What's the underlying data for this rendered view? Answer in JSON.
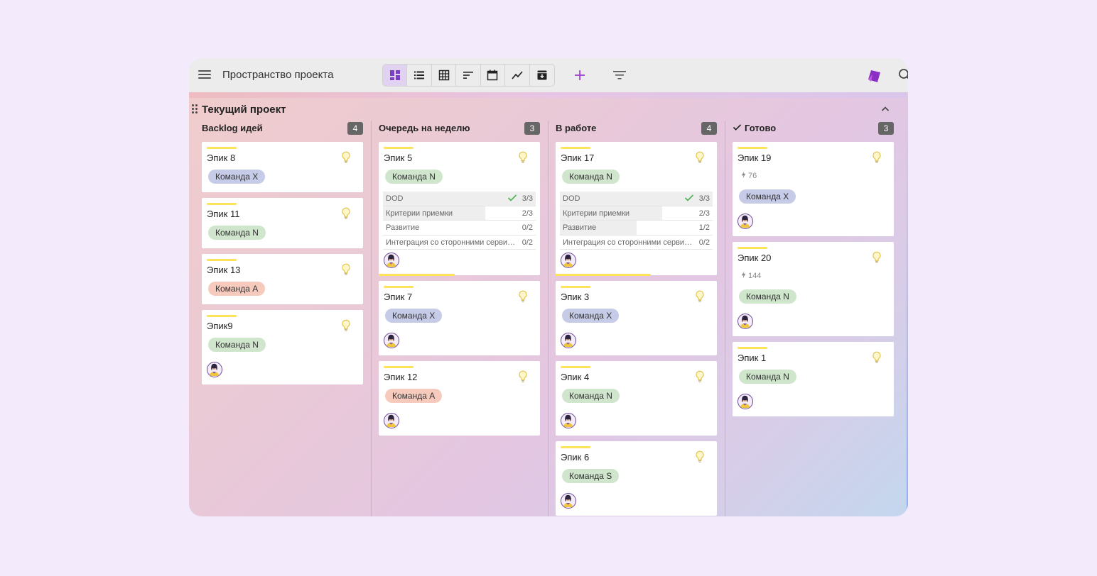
{
  "toolbar": {
    "title": "Пространство проекта",
    "views": [
      "board-icon",
      "list-icon",
      "table-icon",
      "sort-icon",
      "calendar-icon",
      "chart-icon",
      "archive-icon"
    ],
    "active_view": "board-icon",
    "accent": "#9b3fd1"
  },
  "board": {
    "section_title": "Текущий проект",
    "columns": [
      {
        "title": "Backlog идей",
        "count": "4",
        "cards": [
          {
            "title": "Эпик 8",
            "tag": "Команда X",
            "tag_color": "x"
          },
          {
            "title": "Эпик 11",
            "tag": "Команда N",
            "tag_color": "n"
          },
          {
            "title": "Эпик 13",
            "tag": "Команда A",
            "tag_color": "a"
          },
          {
            "title": "Эпик9",
            "tag": "Команда N",
            "tag_color": "n",
            "avatar": true
          }
        ]
      },
      {
        "title": "Очередь на неделю",
        "count": "3",
        "cards": [
          {
            "title": "Эпик 5",
            "tag": "Команда N",
            "tag_color": "n",
            "avatar": true,
            "progress": 0.47,
            "checklist": [
              {
                "label": "DOD",
                "value": "3/3",
                "done": true,
                "fill": 1.0
              },
              {
                "label": "Критерии приемки",
                "value": "2/3",
                "fill": 0.67
              },
              {
                "label": "Развитие",
                "value": "0/2",
                "fill": 0.0
              },
              {
                "label": "Интеграция со сторонними сервисами",
                "value": "0/2",
                "fill": 0.0
              }
            ]
          },
          {
            "title": "Эпик 7",
            "tag": "Команда X",
            "tag_color": "x",
            "avatar": true
          },
          {
            "title": "Эпик 12",
            "tag": "Команда A",
            "tag_color": "a",
            "avatar": true
          }
        ]
      },
      {
        "title": "В работе",
        "count": "4",
        "cards": [
          {
            "title": "Эпик 17",
            "tag": "Команда N",
            "tag_color": "n",
            "avatar": true,
            "progress": 0.59,
            "checklist": [
              {
                "label": "DOD",
                "value": "3/3",
                "done": true,
                "fill": 1.0
              },
              {
                "label": "Критерии приемки",
                "value": "2/3",
                "fill": 0.67
              },
              {
                "label": "Развитие",
                "value": "1/2",
                "fill": 0.5
              },
              {
                "label": "Интеграция со сторонними сервисами",
                "value": "0/2",
                "fill": 0.0
              }
            ]
          },
          {
            "title": "Эпик 3",
            "tag": "Команда X",
            "tag_color": "x",
            "avatar": true
          },
          {
            "title": "Эпик 4",
            "tag": "Команда N",
            "tag_color": "n",
            "avatar": true
          },
          {
            "title": "Эпик 6",
            "tag": "Команда S",
            "tag_color": "s",
            "avatar": true
          }
        ]
      },
      {
        "title": "Готово",
        "count": "3",
        "done": true,
        "cards": [
          {
            "title": "Эпик 19",
            "metric": "76",
            "tag": "Команда X",
            "tag_color": "x",
            "avatar": true
          },
          {
            "title": "Эпик 20",
            "metric": "144",
            "tag": "Команда N",
            "tag_color": "n",
            "avatar": true
          },
          {
            "title": "Эпик 1",
            "tag": "Команда N",
            "tag_color": "n",
            "avatar": true
          }
        ]
      }
    ]
  }
}
